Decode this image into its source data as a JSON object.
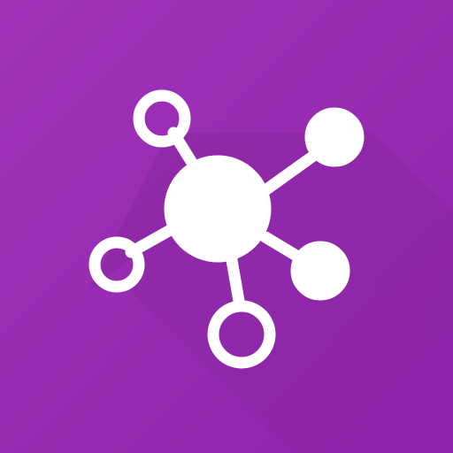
{
  "icon": {
    "name": "network-graph-icon",
    "colors": {
      "background_top": "#a033b8",
      "background_bottom": "#8e24aa",
      "foreground": "#ffffff",
      "shadow": "#6a1b7d"
    }
  }
}
